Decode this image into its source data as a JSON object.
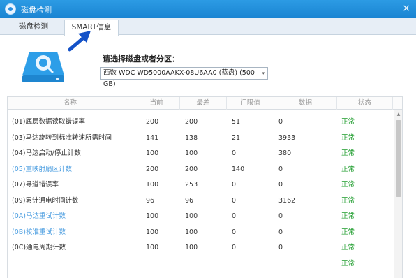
{
  "window": {
    "title": "磁盘检测",
    "close_glyph": "×"
  },
  "tabs": [
    {
      "label": "磁盘检测",
      "active": false
    },
    {
      "label": "SMART信息",
      "active": true
    }
  ],
  "disk_select": {
    "prompt": "请选择磁盘或者分区：",
    "value": "西数 WDC WD5000AAKX-08U6AA0 (蓝盘) (500 GB)",
    "arrow_glyph": "▾"
  },
  "table": {
    "columns": [
      "名称",
      "当前",
      "最差",
      "门限值",
      "数据",
      "状态"
    ],
    "rows": [
      {
        "name": "(01)底层数据读取错误率",
        "current": "200",
        "worst": "200",
        "threshold": "51",
        "data": "0",
        "status": "正常",
        "link": false
      },
      {
        "name": "(03)马达旋转到标准转速所需时间",
        "current": "141",
        "worst": "138",
        "threshold": "21",
        "data": "3933",
        "status": "正常",
        "link": false
      },
      {
        "name": "(04)马达启动/停止计数",
        "current": "100",
        "worst": "100",
        "threshold": "0",
        "data": "380",
        "status": "正常",
        "link": false
      },
      {
        "name": "(05)重映射扇区计数",
        "current": "200",
        "worst": "200",
        "threshold": "140",
        "data": "0",
        "status": "正常",
        "link": true
      },
      {
        "name": "(07)寻道错误率",
        "current": "100",
        "worst": "253",
        "threshold": "0",
        "data": "0",
        "status": "正常",
        "link": false
      },
      {
        "name": "(09)累计通电时间计数",
        "current": "96",
        "worst": "96",
        "threshold": "0",
        "data": "3162",
        "status": "正常",
        "link": false
      },
      {
        "name": "(0A)马达重试计数",
        "current": "100",
        "worst": "100",
        "threshold": "0",
        "data": "0",
        "status": "正常",
        "link": true
      },
      {
        "name": "(0B)校准重试计数",
        "current": "100",
        "worst": "100",
        "threshold": "0",
        "data": "0",
        "status": "正常",
        "link": true
      },
      {
        "name": "(0C)通电周期计数",
        "current": "100",
        "worst": "100",
        "threshold": "0",
        "data": "0",
        "status": "正常",
        "link": false
      },
      {
        "name": "",
        "current": "",
        "worst": "",
        "threshold": "",
        "data": "",
        "status": "正常",
        "link": false
      }
    ]
  },
  "colors": {
    "titlebar": "#1a84d2",
    "ok": "#1b9b2a",
    "link": "#4a9de0",
    "arrow": "#1452c8"
  },
  "icons": [
    "disk-icon",
    "app-icon",
    "arrow-icon"
  ]
}
